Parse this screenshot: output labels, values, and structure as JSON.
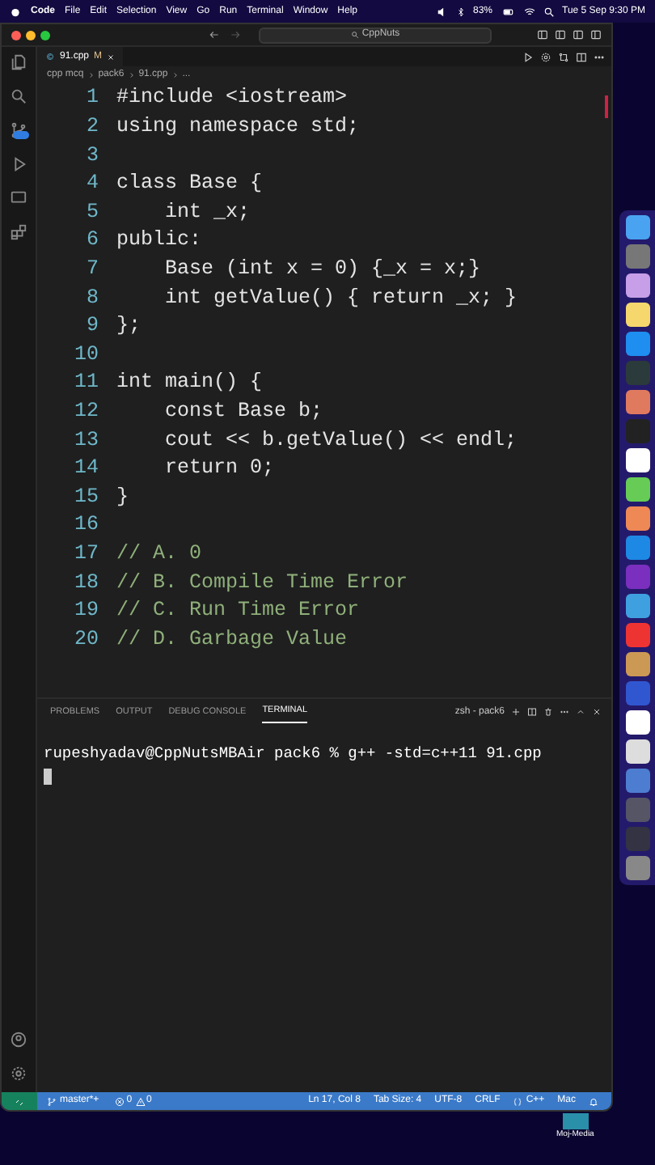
{
  "menu_bar": {
    "app": "Code",
    "items": [
      "File",
      "Edit",
      "Selection",
      "View",
      "Go",
      "Run",
      "Terminal",
      "Window",
      "Help"
    ],
    "battery": "83%",
    "clock": "Tue 5 Sep  9:30 PM"
  },
  "window": {
    "search": "CppNuts"
  },
  "tabs": [
    {
      "label": "91.cpp",
      "badge": "M",
      "selected": true
    }
  ],
  "breadcrumb": [
    "cpp mcq",
    "pack6",
    "91.cpp",
    "..."
  ],
  "editor": {
    "lines": [
      {
        "number": "1",
        "tokens": [
          {
            "text": "#include <iostream>",
            "kind": "code"
          }
        ]
      },
      {
        "number": "2",
        "tokens": [
          {
            "text": "using namespace std;",
            "kind": "code"
          }
        ]
      },
      {
        "number": "3"
      },
      {
        "number": "4",
        "tokens": [
          {
            "text": "class Base {",
            "kind": "code"
          }
        ]
      },
      {
        "number": "5",
        "tokens": [
          {
            "text": "    int _x;",
            "kind": "code"
          }
        ]
      },
      {
        "number": "6",
        "tokens": [
          {
            "text": "public:",
            "kind": "code"
          }
        ]
      },
      {
        "number": "7",
        "tokens": [
          {
            "text": "    Base (int x = 0) {_x = x;}",
            "kind": "code"
          }
        ]
      },
      {
        "number": "8",
        "tokens": [
          {
            "text": "    int getValue() { return _x; }",
            "kind": "code"
          }
        ]
      },
      {
        "number": "9",
        "tokens": [
          {
            "text": "};",
            "kind": "code"
          }
        ]
      },
      {
        "number": "10"
      },
      {
        "number": "11",
        "tokens": [
          {
            "text": "int main() {",
            "kind": "code"
          }
        ]
      },
      {
        "number": "12",
        "tokens": [
          {
            "text": "    const Base b;",
            "kind": "code"
          }
        ]
      },
      {
        "number": "13",
        "tokens": [
          {
            "text": "    cout << b.getValue() << endl;",
            "kind": "code"
          }
        ]
      },
      {
        "number": "14",
        "tokens": [
          {
            "text": "    return 0;",
            "kind": "code"
          }
        ]
      },
      {
        "number": "15",
        "tokens": [
          {
            "text": "}",
            "kind": "code"
          }
        ]
      },
      {
        "number": "16"
      },
      {
        "number": "17",
        "tokens": [
          {
            "text": "// A. 0",
            "kind": "comment"
          }
        ]
      },
      {
        "number": "18",
        "tokens": [
          {
            "text": "// B. Compile Time Error",
            "kind": "comment"
          }
        ]
      },
      {
        "number": "19",
        "tokens": [
          {
            "text": "// C. Run Time Error",
            "kind": "comment"
          }
        ]
      },
      {
        "number": "20",
        "tokens": [
          {
            "text": "// D. Garbage Value",
            "kind": "comment"
          }
        ]
      }
    ]
  },
  "panel": {
    "tabs": [
      {
        "label": "PROBLEMS",
        "selected": false
      },
      {
        "label": "OUTPUT",
        "selected": false
      },
      {
        "label": "DEBUG CONSOLE",
        "selected": false
      },
      {
        "label": "TERMINAL",
        "selected": true
      }
    ],
    "terminal_name": "zsh - pack6",
    "prompt": "rupeshyadav@CppNutsMBAir pack6 % g++ -std=c++11 91.cpp"
  },
  "status_bar": {
    "branch": "master*+",
    "errors": "0",
    "warnings": "0",
    "position": "Ln 17, Col 8",
    "tab_size": "Tab Size: 4",
    "encoding": "UTF-8",
    "line_ending": "CRLF",
    "language": "C++",
    "os": "Mac"
  },
  "desktop": {
    "icon_label": "Moj-Media"
  }
}
